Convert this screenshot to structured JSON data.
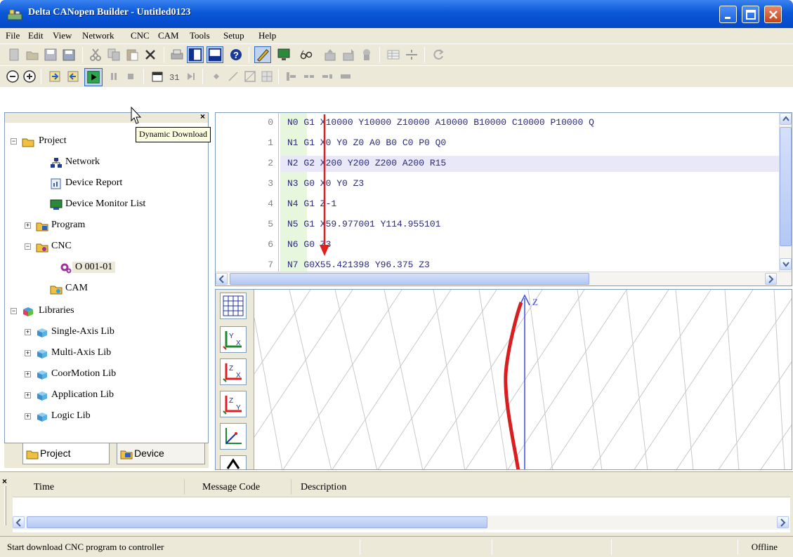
{
  "window": {
    "title": "Delta CANopen Builder - Untitled0123"
  },
  "menu": [
    "File",
    "Edit",
    "View",
    "Network",
    "CNC",
    "CAM",
    "Tools",
    "Setup",
    "Help"
  ],
  "tooltip": "Dynamic Download",
  "tree": {
    "project": "Project",
    "network": "Network",
    "device_report": "Device Report",
    "device_monitor_list": "Device Monitor List",
    "program": "Program",
    "cnc": "CNC",
    "cnc_item": "O 001-01",
    "cam": "CAM",
    "libraries": "Libraries",
    "single_axis": "Single-Axis Lib",
    "multi_axis": "Multi-Axis Lib",
    "coor_motion": "CoorMotion Lib",
    "application": "Application Lib",
    "logic": "Logic Lib"
  },
  "tabs": {
    "project": "Project",
    "device": "Device"
  },
  "editor": {
    "lines": [
      {
        "num": "0",
        "code": "N0 G1 X10000 Y10000 Z10000 A10000 B10000 C10000 P10000 Q"
      },
      {
        "num": "1",
        "code": "N1 G1 X0 Y0 Z0 A0 B0 C0 P0 Q0"
      },
      {
        "num": "2",
        "code": "N2 G2 X200 Y200 Z200 A200 R15"
      },
      {
        "num": "3",
        "code": "N3 G0 X0 Y0 Z3"
      },
      {
        "num": "4",
        "code": "N4 G1 Z-1"
      },
      {
        "num": "5",
        "code": "N5 G1 X59.977001 Y114.955101"
      },
      {
        "num": "6",
        "code": "N6 G0 Z3"
      },
      {
        "num": "7",
        "code": "N7 G0X55.421398 Y96.375 Z3"
      }
    ]
  },
  "plot": {
    "axis_label": "Z"
  },
  "messages": {
    "col_time": "Time",
    "col_code": "Message Code",
    "col_desc": "Description"
  },
  "status": {
    "text": "Start download CNC program to controller",
    "state": "Offline"
  },
  "colors": {
    "title_blue": "#0a58d8",
    "face": "#ece9d8",
    "arrow_red": "#e0201c",
    "trace_red": "#d81e1e",
    "axis_blue": "#3a4ce0"
  }
}
